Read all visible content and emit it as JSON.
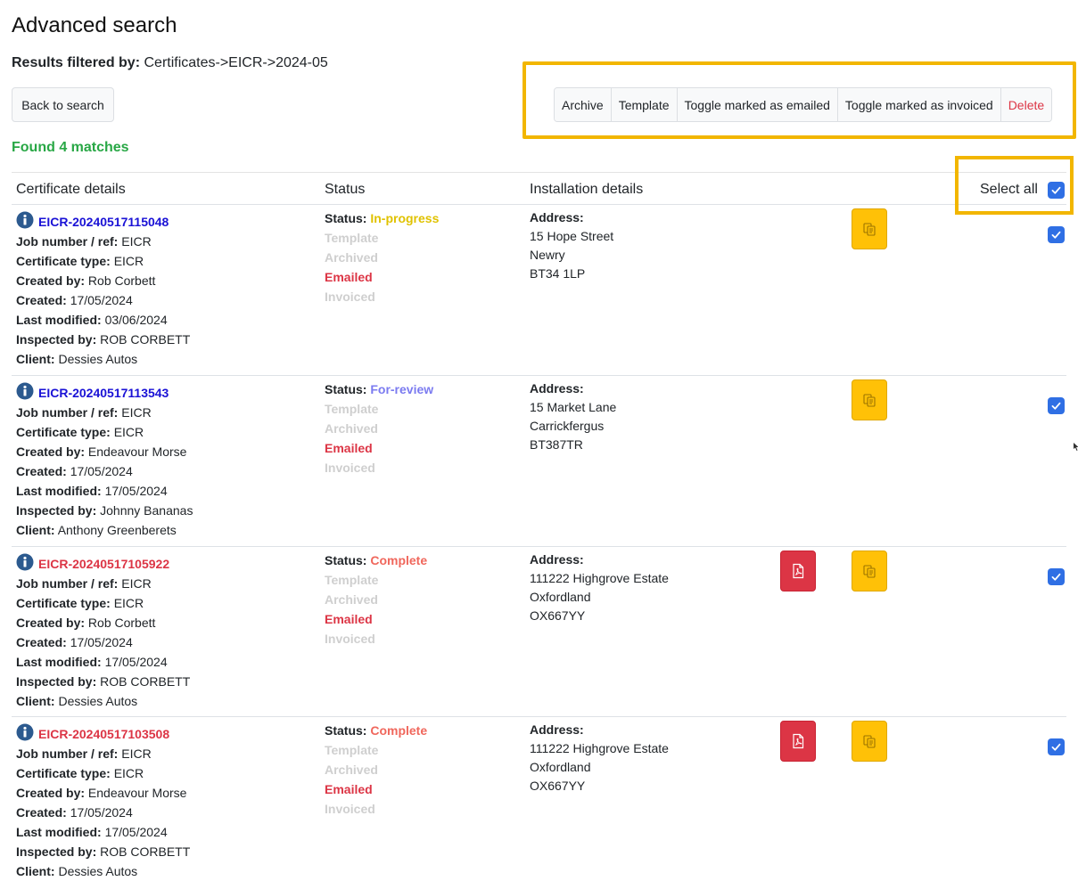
{
  "page": {
    "title": "Advanced search",
    "filter_label": "Results filtered by:",
    "filter_value": "Certificates->EICR->2024-05",
    "back_label": "Back to search",
    "found_text": "Found 4 matches"
  },
  "toolbar": {
    "buttons": [
      "Archive",
      "Template",
      "Toggle marked as emailed",
      "Toggle marked as invoiced",
      "Delete"
    ]
  },
  "table": {
    "headers": [
      "Certificate details",
      "Status",
      "Installation details"
    ],
    "select_all_label": "Select all"
  },
  "colors": {
    "link_blue": "#1a12d6",
    "link_red": "#dc3545",
    "status_in_progress": "#e0c200",
    "status_for_review": "#7b7bf0",
    "status_complete": "#f0675c",
    "found_green": "#28a745",
    "highlight": "#f2b600"
  },
  "field_labels": {
    "job": "Job number / ref:",
    "type": "Certificate type:",
    "created_by": "Created by:",
    "created": "Created:",
    "modified": "Last modified:",
    "inspected": "Inspected by:",
    "client": "Client:",
    "status": "Status:",
    "address": "Address:",
    "template": "Template",
    "archived": "Archived",
    "emailed": "Emailed",
    "invoiced": "Invoiced"
  },
  "rows": [
    {
      "id": "EICR-20240517115048",
      "id_color": "blue",
      "job": "EICR",
      "type": "EICR",
      "created_by": "Rob Corbett",
      "created": "17/05/2024",
      "modified": "03/06/2024",
      "inspected": "ROB CORBETT",
      "client": "Dessies Autos",
      "status": "In-progress",
      "status_color": "in_progress",
      "emailed": true,
      "address": [
        "15 Hope Street",
        "Newry",
        "BT34 1LP"
      ],
      "has_pdf": false,
      "checked": true
    },
    {
      "id": "EICR-20240517113543",
      "id_color": "blue",
      "job": "EICR",
      "type": "EICR",
      "created_by": "Endeavour Morse",
      "created": "17/05/2024",
      "modified": "17/05/2024",
      "inspected": "Johnny Bananas",
      "client": "Anthony Greenberets",
      "status": "For-review",
      "status_color": "for_review",
      "emailed": true,
      "address": [
        "15 Market Lane",
        "Carrickfergus",
        "BT387TR"
      ],
      "has_pdf": false,
      "checked": true
    },
    {
      "id": "EICR-20240517105922",
      "id_color": "red",
      "job": "EICR",
      "type": "EICR",
      "created_by": "Rob Corbett",
      "created": "17/05/2024",
      "modified": "17/05/2024",
      "inspected": "ROB CORBETT",
      "client": "Dessies Autos",
      "status": "Complete",
      "status_color": "complete",
      "emailed": true,
      "address": [
        "111222 Highgrove Estate",
        "Oxfordland",
        "OX667YY"
      ],
      "has_pdf": true,
      "checked": true
    },
    {
      "id": "EICR-20240517103508",
      "id_color": "red",
      "job": "EICR",
      "type": "EICR",
      "created_by": "Endeavour Morse",
      "created": "17/05/2024",
      "modified": "17/05/2024",
      "inspected": "ROB CORBETT",
      "client": "Dessies Autos",
      "status": "Complete",
      "status_color": "complete",
      "emailed": true,
      "address": [
        "111222 Highgrove Estate",
        "Oxfordland",
        "OX667YY"
      ],
      "has_pdf": true,
      "checked": true
    }
  ],
  "icons": {
    "info": "info-icon",
    "pdf": "pdf-icon",
    "copy": "copy-icon",
    "check": "checkmark-icon"
  }
}
